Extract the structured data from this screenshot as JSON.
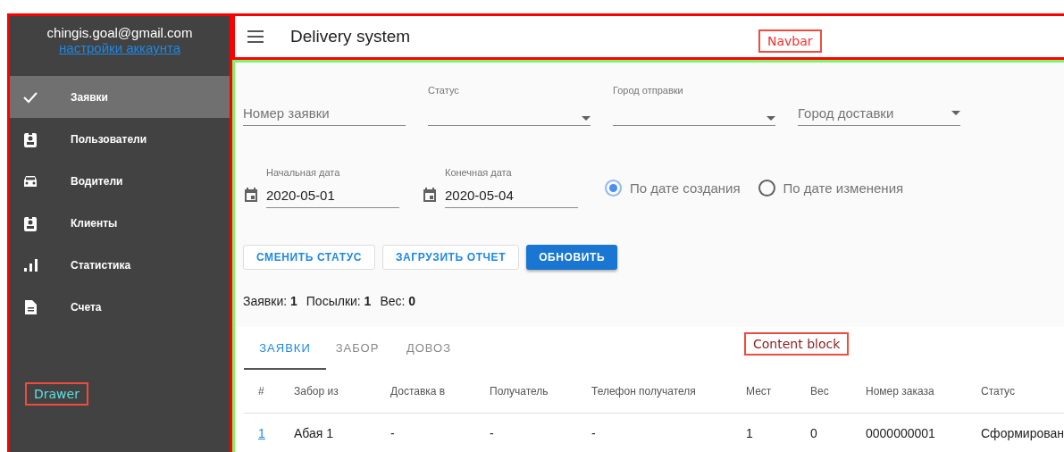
{
  "drawer": {
    "email": "chingis.goal@gmail.com",
    "account_link": "настройки аккаунта",
    "items": [
      {
        "label": "Заявки",
        "selected": true
      },
      {
        "label": "Пользователи",
        "selected": false
      },
      {
        "label": "Водители",
        "selected": false
      },
      {
        "label": "Клиенты",
        "selected": false
      },
      {
        "label": "Статистика",
        "selected": false
      },
      {
        "label": "Счета",
        "selected": false
      }
    ]
  },
  "navbar": {
    "title": "Delivery system"
  },
  "filters": [
    {
      "kind": "text",
      "placeholder": "Номер заявки"
    },
    {
      "kind": "select",
      "label": "Статус"
    },
    {
      "kind": "select",
      "label": "Город отправки"
    },
    {
      "kind": "select",
      "placeholder": "Город доставки"
    }
  ],
  "dates": [
    {
      "label": "Начальная дата",
      "value": "2020-05-01"
    },
    {
      "label": "Конечная дата",
      "value": "2020-05-04"
    }
  ],
  "date_mode": [
    {
      "label": "По дате создания",
      "selected": true
    },
    {
      "label": "По дате изменения",
      "selected": false
    }
  ],
  "buttons": [
    {
      "label": "СМЕНИТЬ СТАТУС",
      "kind": "outlined"
    },
    {
      "label": "ЗАГРУЗИТЬ ОТЧЕТ",
      "kind": "outlined"
    },
    {
      "label": "ОБНОВИТЬ",
      "kind": "contained"
    }
  ],
  "summary": [
    "Заявки: **1**",
    "Посылки: **1**",
    "Вес: **0**"
  ],
  "tabs": [
    {
      "label": "ЗАЯВКИ",
      "selected": true
    },
    {
      "label": "ЗАБОР",
      "selected": false
    },
    {
      "label": "ДОВОЗ",
      "selected": false
    }
  ],
  "table": {
    "columns": [
      "#",
      "Забор из",
      "Доставка в",
      "Получатель",
      "Телефон получателя",
      "Мест",
      "Вес",
      "Номер заказа",
      "Статус"
    ],
    "rows": [
      [
        "1",
        "Абая 1",
        "-",
        "-",
        "-",
        "1",
        "0",
        "0000000001",
        "Сформирован"
      ]
    ]
  },
  "annotations": [
    {
      "kind": "navbar",
      "label": "Navbar",
      "color": "#ff2b2b"
    },
    {
      "kind": "drawer",
      "label": "Drawer",
      "color": "#5ee0e6"
    },
    {
      "kind": "content",
      "label": "Content block",
      "color": "#8b1a1a"
    }
  ]
}
